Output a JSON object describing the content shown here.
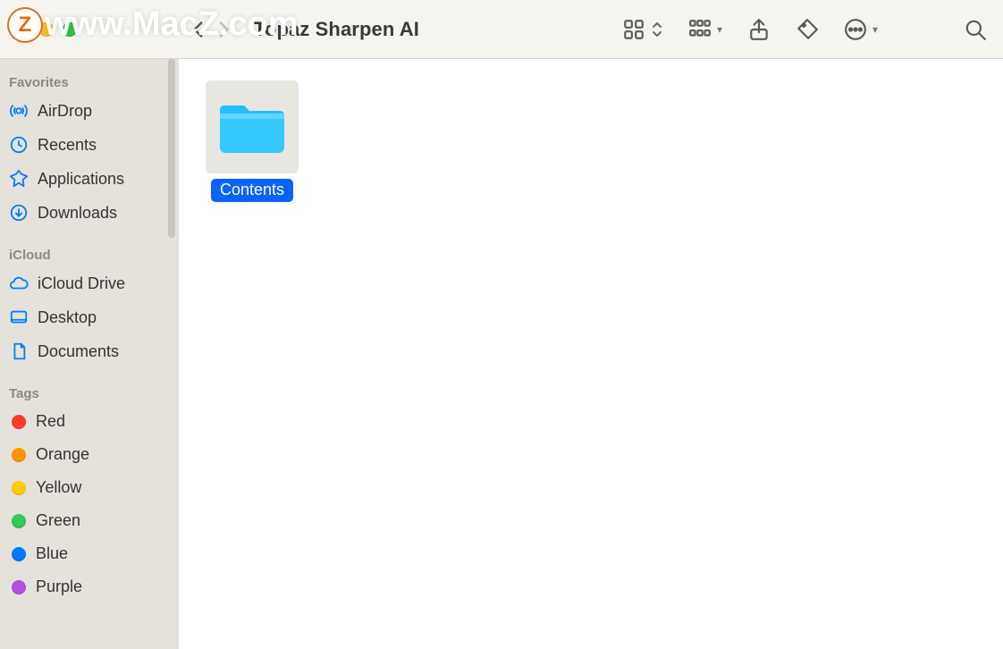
{
  "watermark": {
    "badge": "Z",
    "text": "www.MacZ.com"
  },
  "toolbar": {
    "title": "Topaz Sharpen AI"
  },
  "sidebar": {
    "sections": {
      "favorites": {
        "title": "Favorites",
        "items": [
          {
            "label": "AirDrop"
          },
          {
            "label": "Recents"
          },
          {
            "label": "Applications"
          },
          {
            "label": "Downloads"
          }
        ]
      },
      "icloud": {
        "title": "iCloud",
        "items": [
          {
            "label": "iCloud Drive"
          },
          {
            "label": "Desktop"
          },
          {
            "label": "Documents"
          }
        ]
      },
      "tags": {
        "title": "Tags",
        "items": [
          {
            "label": "Red",
            "color": "#ff3b30"
          },
          {
            "label": "Orange",
            "color": "#ff9500"
          },
          {
            "label": "Yellow",
            "color": "#ffcc00"
          },
          {
            "label": "Green",
            "color": "#34c759"
          },
          {
            "label": "Blue",
            "color": "#007aff"
          },
          {
            "label": "Purple",
            "color": "#af52de"
          }
        ]
      }
    }
  },
  "content": {
    "items": [
      {
        "label": "Contents",
        "selected": true
      }
    ]
  }
}
